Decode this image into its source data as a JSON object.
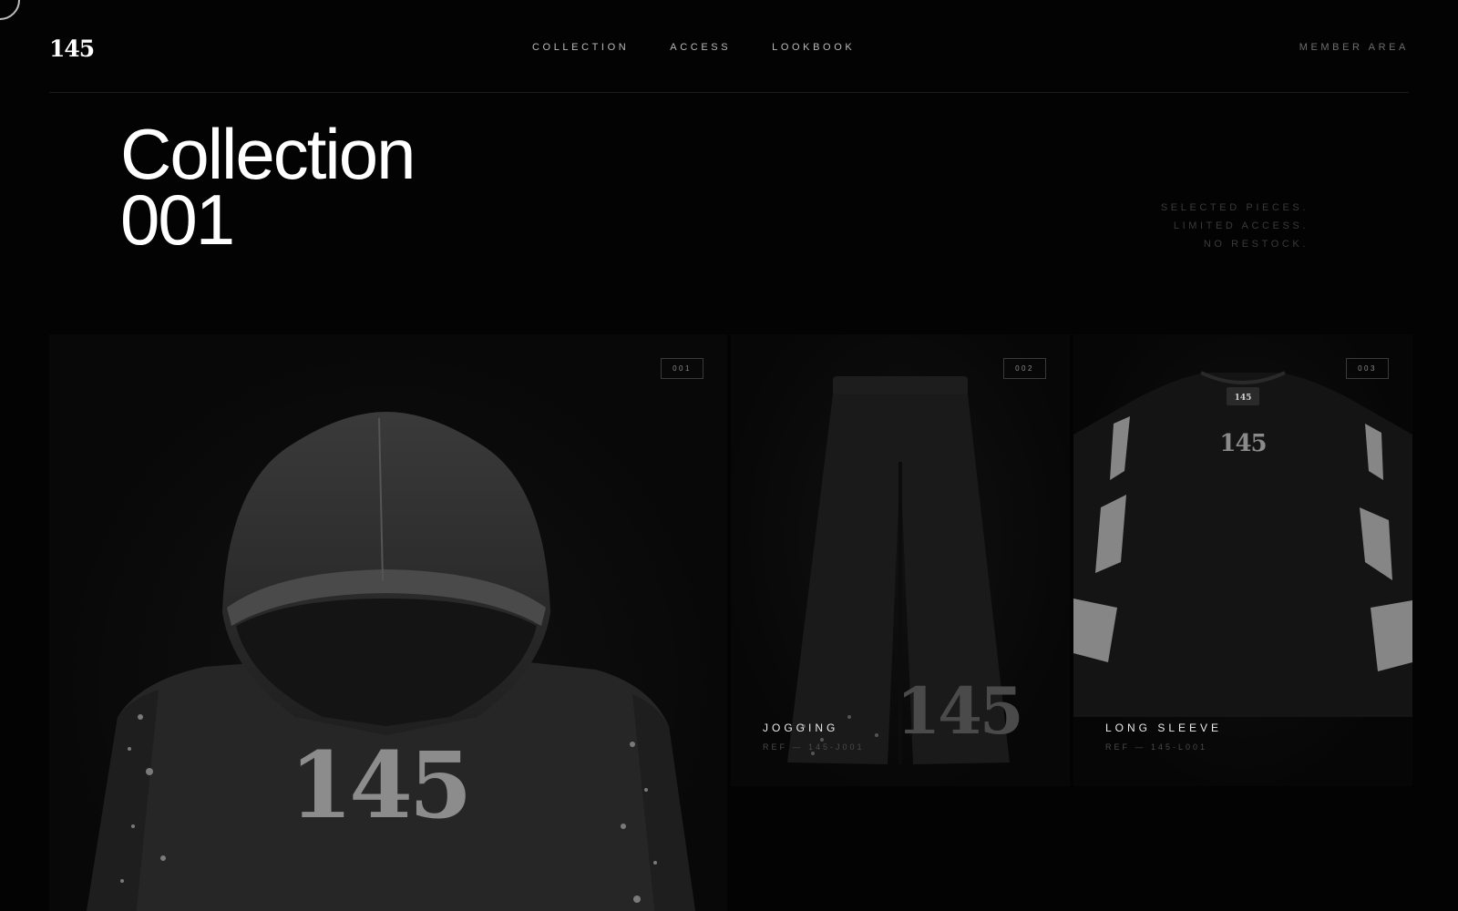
{
  "header": {
    "logo": "145",
    "nav": [
      "COLLECTION",
      "ACCESS",
      "LOOKBOOK"
    ],
    "member": "MEMBER AREA"
  },
  "hero": {
    "line1": "Collection",
    "line2": "001",
    "tagline": [
      "SELECTED PIECES.",
      "LIMITED ACCESS.",
      "NO RESTOCK."
    ]
  },
  "products": [
    {
      "index": "001",
      "name": "",
      "ref": "",
      "graphic": "145",
      "image": "hoodie"
    },
    {
      "index": "002",
      "name": "JOGGING",
      "ref": "REF — 145-J001",
      "graphic": "145",
      "image": "jogging pants"
    },
    {
      "index": "003",
      "name": "LONG SLEEVE",
      "ref": "REF — 145-L001",
      "graphic": "145",
      "image": "long sleeve shirt"
    }
  ]
}
